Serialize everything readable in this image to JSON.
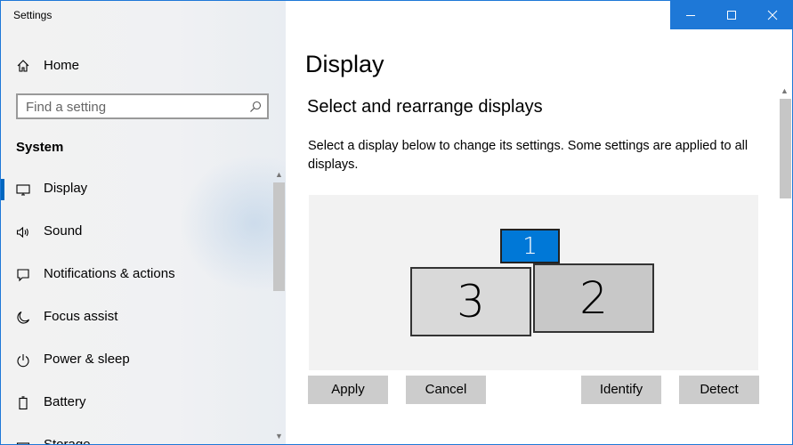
{
  "window": {
    "title": "Settings"
  },
  "titlebar": {
    "minimize_icon": "minimize-icon",
    "maximize_icon": "maximize-icon",
    "close_icon": "close-icon",
    "accent": "#1e78d7"
  },
  "sidebar": {
    "home_label": "Home",
    "search_placeholder": "Find a setting",
    "section_title": "System",
    "items": [
      {
        "label": "Display",
        "icon": "monitor-icon",
        "selected": true
      },
      {
        "label": "Sound",
        "icon": "speaker-icon",
        "selected": false
      },
      {
        "label": "Notifications & actions",
        "icon": "notifications-icon",
        "selected": false
      },
      {
        "label": "Focus assist",
        "icon": "moon-icon",
        "selected": false
      },
      {
        "label": "Power & sleep",
        "icon": "power-icon",
        "selected": false
      },
      {
        "label": "Battery",
        "icon": "battery-icon",
        "selected": false
      },
      {
        "label": "Storage",
        "icon": "storage-icon",
        "selected": false
      }
    ]
  },
  "main": {
    "page_title": "Display",
    "heading": "Select and rearrange displays",
    "description": "Select a display below to change its settings. Some settings are applied to all displays.",
    "monitors": [
      {
        "number": "1",
        "selected": true
      },
      {
        "number": "2",
        "selected": false
      },
      {
        "number": "3",
        "selected": false
      }
    ],
    "buttons": {
      "apply": "Apply",
      "cancel": "Cancel",
      "identify": "Identify",
      "detect": "Detect"
    }
  },
  "colors": {
    "accent": "#0078d7",
    "selection_bar": "#0067c0"
  }
}
